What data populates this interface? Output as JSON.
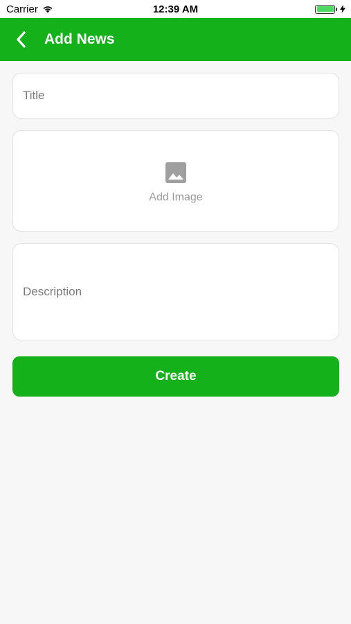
{
  "status_bar": {
    "carrier": "Carrier",
    "time": "12:39 AM"
  },
  "nav": {
    "title": "Add News"
  },
  "form": {
    "title_placeholder": "Title",
    "image_label": "Add Image",
    "description_placeholder": "Description",
    "create_label": "Create"
  },
  "colors": {
    "accent": "#14b11b",
    "background": "#f7f7f7",
    "battery": "#4cd964"
  },
  "icons": {
    "back": "chevron-left-icon",
    "image": "image-icon",
    "wifi": "wifi-icon",
    "battery": "battery-icon",
    "charging": "bolt-icon"
  }
}
